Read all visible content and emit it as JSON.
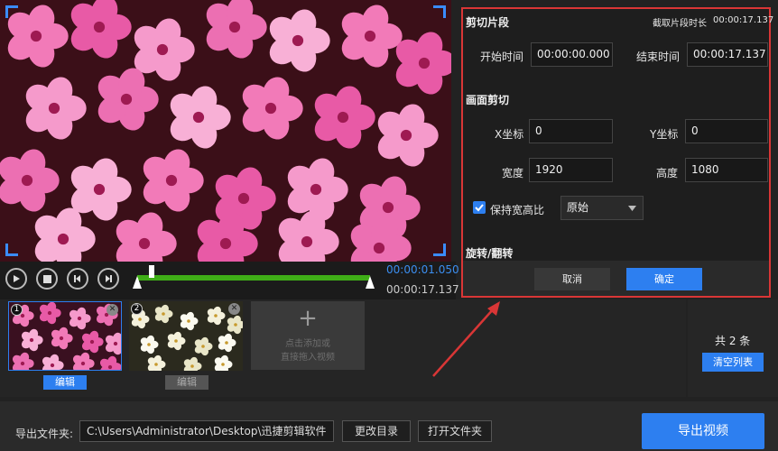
{
  "player": {
    "current_time": "00:00:01.050",
    "total_time": "00:00:17.137",
    "playhead_fraction": 0.061
  },
  "trim_panel": {
    "section_clip_title": "剪切片段",
    "clip_duration_label": "截取片段时长",
    "clip_duration_value": "00:00:17.137",
    "start_label": "开始时间",
    "start_value": "00:00:00.000",
    "end_label": "结束时间",
    "end_value": "00:00:17.137",
    "section_crop_title": "画面剪切",
    "x_label": "X坐标",
    "x_value": "0",
    "y_label": "Y坐标",
    "y_value": "0",
    "width_label": "宽度",
    "width_value": "1920",
    "height_label": "高度",
    "height_value": "1080",
    "keep_ratio_label": "保持宽高比",
    "keep_ratio_checked": true,
    "ratio_select": "原始",
    "section_rotate_title": "旋转/翻转",
    "cancel_label": "取消",
    "confirm_label": "确定"
  },
  "clips": [
    {
      "index": "1",
      "edit_label": "编辑",
      "selected": true
    },
    {
      "index": "2",
      "edit_label": "编辑",
      "selected": false
    }
  ],
  "add_clip": {
    "line1": "点击添加或",
    "line2": "直接拖入视频"
  },
  "list_info": {
    "count_label": "共 2 条",
    "clear_label": "清空列表"
  },
  "output": {
    "folder_label": "导出文件夹:",
    "folder_path": "C:\\Users\\Administrator\\Desktop\\迅捷剪辑软件",
    "change_dir_label": "更改目录",
    "open_folder_label": "打开文件夹",
    "export_label": "导出视频"
  },
  "colors": {
    "accent_blue": "#2d7ff0",
    "highlight_red": "#d93636",
    "track_green": "#3fae17"
  }
}
